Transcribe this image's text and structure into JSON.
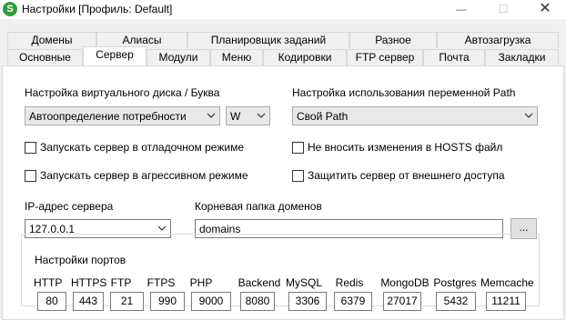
{
  "window": {
    "title": "Настройки [Профиль: Default]",
    "icon_letter": "S",
    "min_glyph": "—",
    "max_glyph": "☐",
    "close_glyph": "✕"
  },
  "tabs_row1": [
    "Домены",
    "Алиасы",
    "Планировщик заданий",
    "Разное",
    "Автозагрузка"
  ],
  "tabs_row2": [
    "Основные",
    "Сервер",
    "Модули",
    "Меню",
    "Кодировки",
    "FTP сервер",
    "Почта",
    "Закладки"
  ],
  "active_tab": "Сервер",
  "server": {
    "vdisk_label": "Настройка виртуального диска / Буква",
    "vdisk_value": "Автоопределение потребности",
    "letter_value": "W",
    "path_label": "Настройка использования переменной Path",
    "path_value": "Свой Path",
    "chk_debug": "Запускать сервер в отладочном режиме",
    "chk_hosts": "Не вносить изменения в HOSTS файл",
    "chk_aggressive": "Запускать сервер в агрессивном режиме",
    "chk_protect": "Защитить сервер от внешнего доступа",
    "ip_label": "IP-адрес сервера",
    "ip_value": "127.0.0.1",
    "root_label": "Корневая папка доменов",
    "root_value": "domains",
    "browse_label": "...",
    "ports_title": "Настройки портов",
    "ports": [
      {
        "name": "HTTP",
        "value": "80"
      },
      {
        "name": "HTTPS",
        "value": "443"
      },
      {
        "name": "FTP",
        "value": "21"
      },
      {
        "name": "FTPS",
        "value": "990"
      },
      {
        "name": "PHP",
        "value": "9000"
      },
      {
        "name": "Backend",
        "value": "8080"
      },
      {
        "name": "MySQL",
        "value": "3306"
      },
      {
        "name": "Redis",
        "value": "6379"
      },
      {
        "name": "MongoDB",
        "value": "27017"
      },
      {
        "name": "Postgres",
        "value": "5432"
      },
      {
        "name": "Memcache",
        "value": "11211"
      }
    ]
  }
}
